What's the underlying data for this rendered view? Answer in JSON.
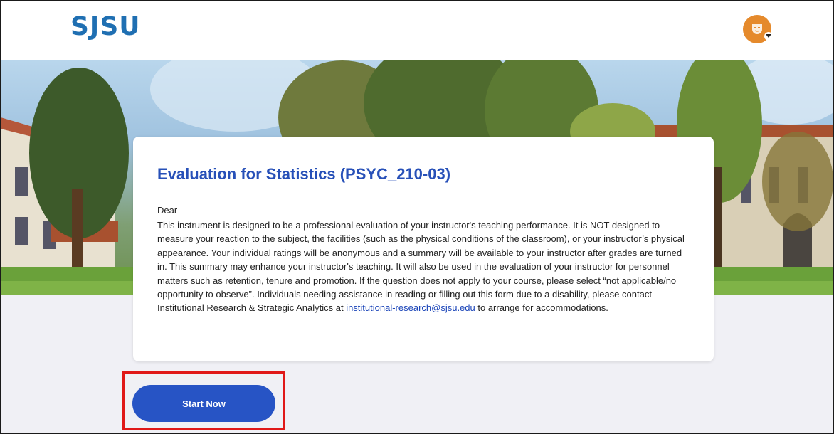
{
  "header": {
    "logo_text": "SJSU",
    "avatar_icon": "user-mask-icon",
    "menu_icon": "caret-down-icon"
  },
  "evaluation": {
    "title": "Evaluation for Statistics (PSYC_210-03)",
    "greeting": "Dear",
    "body_before_link": "This instrument is designed to be a professional evaluation of your instructor's teaching performance. It is NOT designed to measure your reaction to the subject, the facilities (such as the physical conditions of the classroom), or your instructor’s physical appearance. Your individual ratings will be anonymous and a summary will be available to your instructor after grades are turned in. This summary may enhance your instructor's teaching. It will also be used in the evaluation of your instructor for personnel matters such as retention, tenure and promotion. If the question does not apply to your course, please select “not applicable/no opportunity to observe”. Individuals needing assistance in reading or filling out this form due to a disability, please contact Institutional Research & Strategic Analytics at ",
    "email_link": "institutional-research@sjsu.edu",
    "body_after_link": " to arrange for accommodations."
  },
  "actions": {
    "start_label": "Start Now"
  },
  "colors": {
    "brand_blue": "#1f6fb2",
    "title_blue": "#2750b8",
    "button_blue": "#2754c5",
    "avatar_orange": "#e58a2c",
    "highlight_red": "#e01818"
  }
}
